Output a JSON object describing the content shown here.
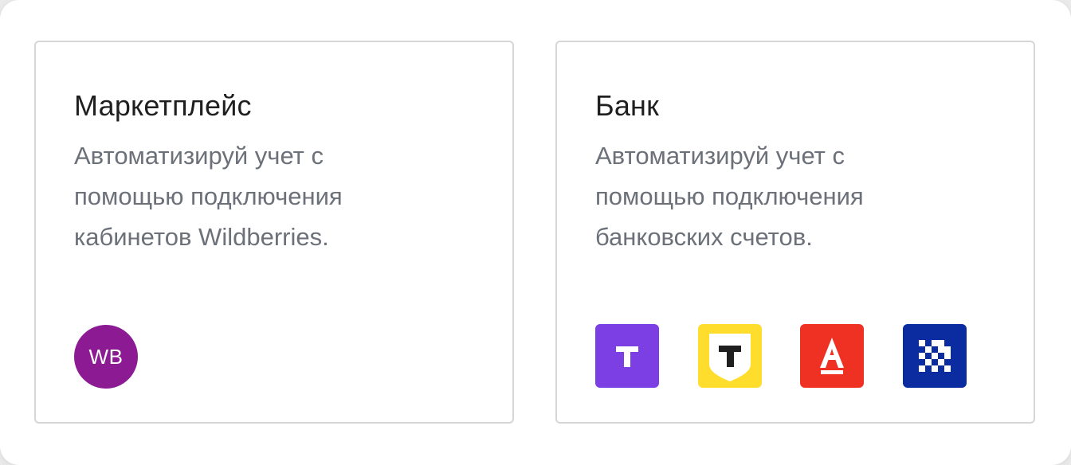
{
  "cards": [
    {
      "title": "Маркетплейс",
      "description": "Автоматизируй учет с помощью подключения кабинетов Wildberries.",
      "logos": [
        {
          "icon": "wildberries-logo-icon",
          "text": "WB",
          "color": "#8b1a93"
        }
      ]
    },
    {
      "title": "Банк",
      "description": "Автоматизируй учет с помощью подключения банковских счетов.",
      "logos": [
        {
          "icon": "t-bank-purple-logo-icon",
          "text": "T",
          "color": "#7b3fe4"
        },
        {
          "icon": "t-bank-yellow-shield-logo-icon",
          "text": "T",
          "color": "#ffdd2d"
        },
        {
          "icon": "alfa-bank-logo-icon",
          "text": "A",
          "color": "#ef3124"
        },
        {
          "icon": "pixel-bank-logo-icon",
          "color": "#0b2ca0"
        }
      ]
    }
  ]
}
